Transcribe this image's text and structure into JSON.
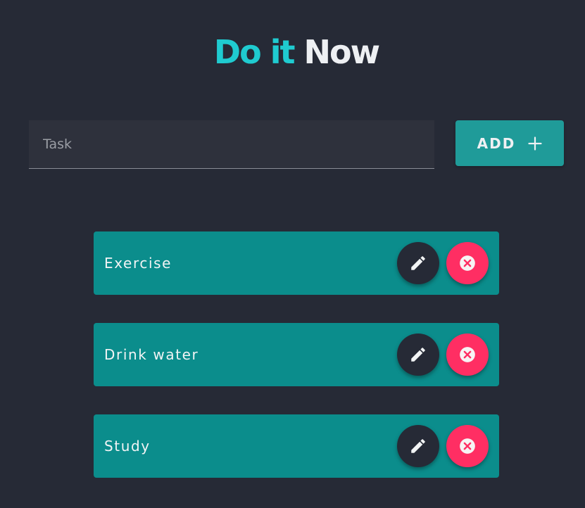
{
  "header": {
    "title_accent": "Do it",
    "title_main": "Now"
  },
  "colors": {
    "background": "#262a36",
    "accent": "#1fcbd0",
    "card": "#0b8d8c",
    "add_button": "#1f9b99",
    "delete": "#ff2e63",
    "edit": "#262a36"
  },
  "task_input": {
    "placeholder": "Task",
    "value": ""
  },
  "add_button": {
    "label": "ADD",
    "icon": "plus-icon"
  },
  "tasks": [
    {
      "text": "Exercise",
      "edit_icon": "pencil-icon",
      "delete_icon": "close-circle-icon"
    },
    {
      "text": "Drink water",
      "edit_icon": "pencil-icon",
      "delete_icon": "close-circle-icon"
    },
    {
      "text": "Study",
      "edit_icon": "pencil-icon",
      "delete_icon": "close-circle-icon"
    }
  ]
}
